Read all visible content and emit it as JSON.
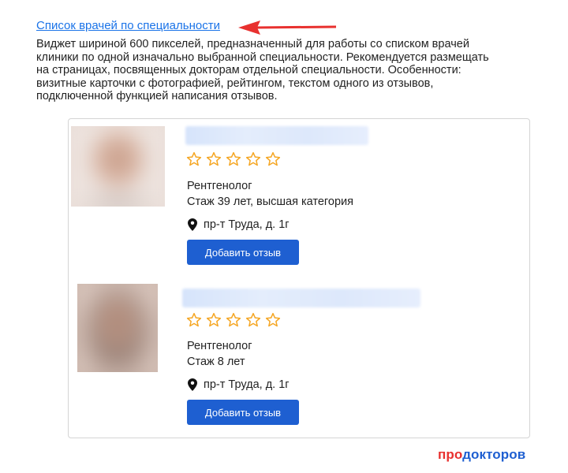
{
  "title_link": "Список врачей по специальности",
  "description": [
    "Виджет шириной 600 пикселей, предназначенный для работы со списком врачей",
    "клиники по одной изначально выбранной специальности. Рекомендуется размещать",
    "на страницах, посвященных докторам отдельной специальности. Особенности:",
    "визитные карточки с фотографией, рейтингом, текстом одного из отзывов,",
    "подключенной функцией написания отзывов."
  ],
  "doctors": [
    {
      "specialty": "Рентгенолог",
      "experience": "Стаж 39 лет, высшая категория",
      "address": "пр-т Труда, д. 1г",
      "button_label": "Добавить отзыв",
      "rating_stars": 0
    },
    {
      "specialty": "Рентгенолог",
      "experience": "Стаж 8 лет",
      "address": "пр-т Труда, д. 1г",
      "button_label": "Добавить отзыв",
      "rating_stars": 0
    }
  ],
  "logo": {
    "part1": "про",
    "part2": "докторов"
  },
  "colors": {
    "link": "#1a73e8",
    "button": "#1e5fd1",
    "star": "#f5a623",
    "arrow": "#e8312f",
    "logo_red": "#e8312f",
    "logo_blue": "#1e5fd1"
  },
  "icons": [
    "arrow-left-icon",
    "star-outline-icon",
    "location-pin-icon"
  ]
}
